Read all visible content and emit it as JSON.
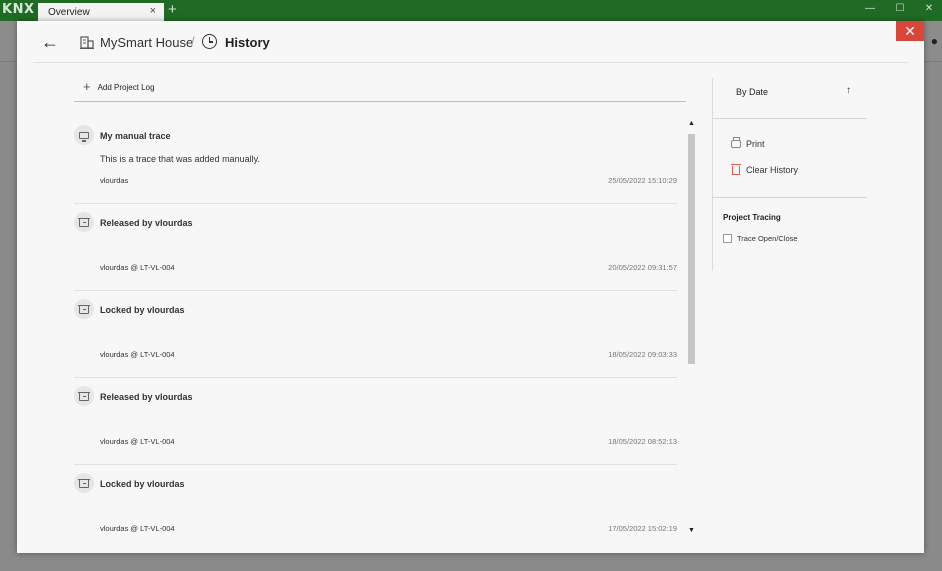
{
  "titlebar": {
    "logo": "KNX",
    "tab_label": "Overview",
    "tab_close": "×",
    "new_tab": "+",
    "minimize": "—",
    "maximize": "☐",
    "close": "✕"
  },
  "dialog": {
    "close": "✕",
    "back": "←",
    "breadcrumb": {
      "project": "MySmart House",
      "separator": "/",
      "current": "History"
    },
    "toolbar": {
      "add_plus": "+",
      "add_log_label": "Add Project Log"
    },
    "logs": [
      {
        "icon": "monitor-icon",
        "title": "My manual trace",
        "description": "This is a trace that was added manually.",
        "user": "vlourdas",
        "date": "25/05/2022 15:10:29"
      },
      {
        "icon": "archive-icon",
        "title": "Released by vlourdas",
        "description": "",
        "user": "vlourdas @ LT-VL-004",
        "date": "20/05/2022 09:31:57"
      },
      {
        "icon": "archive-icon",
        "title": "Locked by vlourdas",
        "description": "",
        "user": "vlourdas @ LT-VL-004",
        "date": "18/05/2022 09:03:33"
      },
      {
        "icon": "archive-icon",
        "title": "Released by vlourdas",
        "description": "",
        "user": "vlourdas @ LT-VL-004",
        "date": "18/05/2022 08:52:13"
      },
      {
        "icon": "archive-icon",
        "title": "Locked by vlourdas",
        "description": "",
        "user": "vlourdas @ LT-VL-004",
        "date": "17/05/2022 15:02:19"
      }
    ],
    "side": {
      "sort_label": "By Date",
      "sort_arrow": "↑",
      "print_label": "Print",
      "clear_label": "Clear History",
      "tracing_title": "Project Tracing",
      "trace_label": "Trace Open/Close",
      "trace_checked": false
    },
    "scroll": {
      "up": "▲",
      "down": "▼"
    }
  },
  "colors": {
    "titlebar": "#1f6b25",
    "close_button": "#d9463a",
    "trash_icon": "#e05a50"
  }
}
